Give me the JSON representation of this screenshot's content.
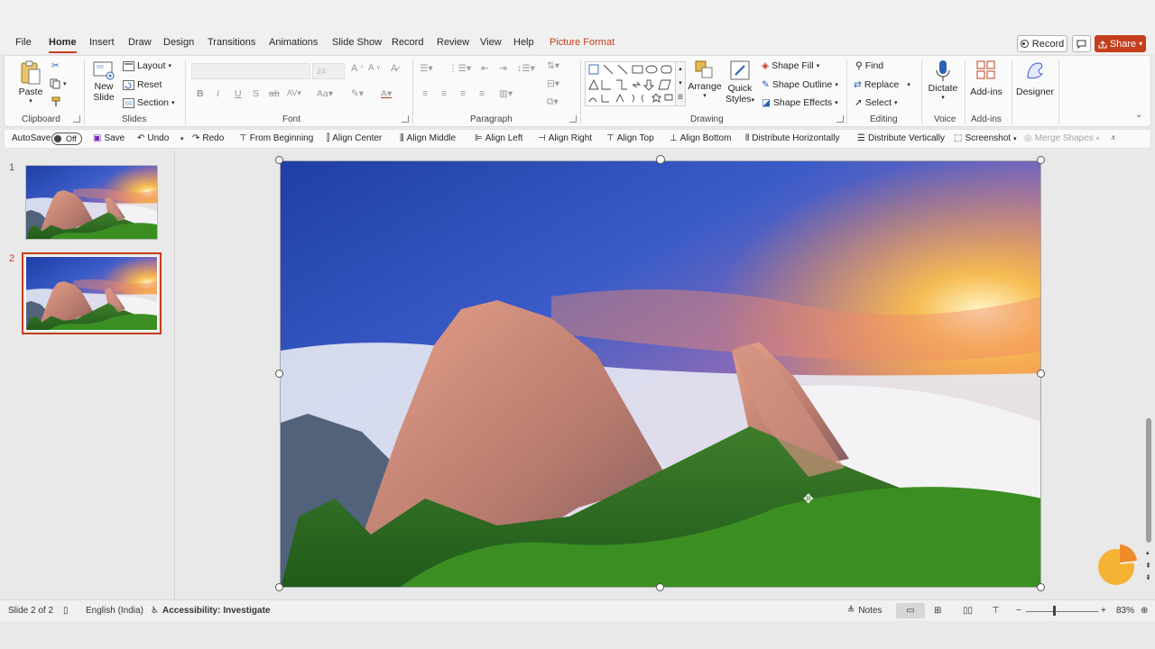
{
  "tabs": [
    "File",
    "Home",
    "Insert",
    "Draw",
    "Design",
    "Transitions",
    "Animations",
    "Slide Show",
    "Record",
    "Review",
    "View",
    "Help",
    "Picture Format"
  ],
  "active_tab": "Home",
  "header_buttons": {
    "record": "Record",
    "share": "Share"
  },
  "ribbon": {
    "clipboard": {
      "paste": "Paste",
      "group": "Clipboard"
    },
    "slides": {
      "new_slide_line1": "New",
      "new_slide_line2": "Slide",
      "layout": "Layout",
      "reset": "Reset",
      "section": "Section",
      "group": "Slides"
    },
    "font": {
      "size": "24",
      "group": "Font"
    },
    "paragraph": {
      "group": "Paragraph"
    },
    "drawing": {
      "arrange": "Arrange",
      "quick_styles_line1": "Quick",
      "quick_styles_line2": "Styles",
      "shape_fill": "Shape Fill",
      "shape_outline": "Shape Outline",
      "shape_effects": "Shape Effects",
      "group": "Drawing"
    },
    "editing": {
      "find": "Find",
      "replace": "Replace",
      "select": "Select",
      "group": "Editing"
    },
    "voice": {
      "dictate": "Dictate",
      "group": "Voice"
    },
    "addins": {
      "addins": "Add-ins",
      "group": "Add-ins"
    },
    "designer": {
      "designer": "Designer"
    }
  },
  "qat": {
    "autosave": "AutoSave",
    "autosave_state": "Off",
    "save": "Save",
    "undo": "Undo",
    "redo": "Redo",
    "from_beginning": "From Beginning",
    "align_center": "Align Center",
    "align_middle": "Align Middle",
    "align_left": "Align Left",
    "align_right": "Align Right",
    "align_top": "Align Top",
    "align_bottom": "Align Bottom",
    "distribute_h": "Distribute Horizontally",
    "distribute_v": "Distribute Vertically",
    "screenshot": "Screenshot",
    "merge_shapes": "Merge Shapes"
  },
  "slides": [
    {
      "number": "1",
      "selected": false
    },
    {
      "number": "2",
      "selected": true
    }
  ],
  "status": {
    "slide_of": "Slide 2 of 2",
    "language": "English (India)",
    "accessibility": "Accessibility: Investigate",
    "notes": "Notes",
    "zoom": "83%"
  },
  "colors": {
    "accent": "#c43e1c",
    "ribbon_bg": "#fafafa",
    "app_bg": "#e9e9e9"
  }
}
